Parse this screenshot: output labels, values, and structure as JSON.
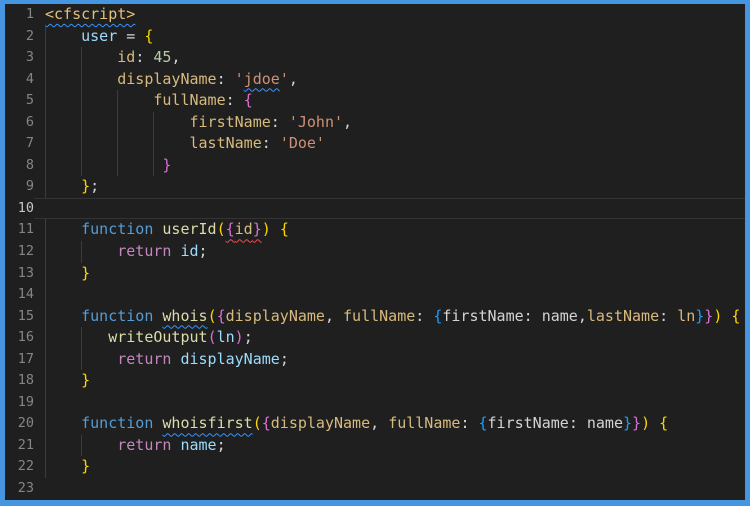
{
  "window": {
    "border_color": "#4595e0",
    "background": "#1f1f1f",
    "language": "cfml"
  },
  "editor": {
    "active_line": 10,
    "colors": {
      "keyword": "#569cd6",
      "control": "#c586c0",
      "func": "#dcdcaa",
      "var": "#9cdcfe",
      "key": "#d7ba7d",
      "str": "#ce9178",
      "num": "#b5cea8",
      "punct": "#d4d4d4",
      "plain": "#d4d4d4",
      "tag": "#e5c07b",
      "b1": "#ffd700",
      "b2": "#da70d6",
      "b3": "#179fff",
      "line_number": "#858585",
      "line_number_active": "#c6c6c6",
      "indent_guide": "#3d3d3d",
      "squiggle_info": "#3794ff",
      "squiggle_error": "#f14c4c"
    },
    "lines": [
      {
        "number": "1",
        "indent": 0,
        "guides": [],
        "tokens": [
          {
            "t": "<cfscript>",
            "c": "tag",
            "sq": "blue"
          }
        ]
      },
      {
        "number": "2",
        "indent": 4,
        "guides": [
          0
        ],
        "tokens": [
          {
            "t": "user",
            "c": "var"
          },
          {
            "t": " = ",
            "c": "punct"
          },
          {
            "t": "{",
            "c": "b1"
          }
        ]
      },
      {
        "number": "3",
        "indent": 8,
        "guides": [
          0,
          4
        ],
        "tokens": [
          {
            "t": "id",
            "c": "key"
          },
          {
            "t": ": ",
            "c": "punct"
          },
          {
            "t": "45",
            "c": "num"
          },
          {
            "t": ",",
            "c": "punct"
          }
        ]
      },
      {
        "number": "4",
        "indent": 8,
        "guides": [
          0,
          4
        ],
        "tokens": [
          {
            "t": "displayName",
            "c": "key"
          },
          {
            "t": ": ",
            "c": "punct"
          },
          {
            "t": "'",
            "c": "str"
          },
          {
            "t": "jdoe",
            "c": "str",
            "sq": "blue"
          },
          {
            "t": "'",
            "c": "str"
          },
          {
            "t": ",",
            "c": "punct"
          }
        ]
      },
      {
        "number": "5",
        "indent": 12,
        "guides": [
          0,
          4,
          8
        ],
        "tokens": [
          {
            "t": "fullName",
            "c": "key"
          },
          {
            "t": ": ",
            "c": "punct"
          },
          {
            "t": "{",
            "c": "b2"
          }
        ]
      },
      {
        "number": "6",
        "indent": 16,
        "guides": [
          0,
          4,
          8,
          12
        ],
        "tokens": [
          {
            "t": "firstName",
            "c": "key"
          },
          {
            "t": ": ",
            "c": "punct"
          },
          {
            "t": "'John'",
            "c": "str"
          },
          {
            "t": ",",
            "c": "punct"
          }
        ]
      },
      {
        "number": "7",
        "indent": 16,
        "guides": [
          0,
          4,
          8,
          12
        ],
        "tokens": [
          {
            "t": "lastName",
            "c": "key"
          },
          {
            "t": ": ",
            "c": "punct"
          },
          {
            "t": "'Doe'",
            "c": "str"
          }
        ]
      },
      {
        "number": "8",
        "indent": 13,
        "guides": [
          0,
          4,
          8,
          12
        ],
        "tokens": [
          {
            "t": "}",
            "c": "b2"
          }
        ]
      },
      {
        "number": "9",
        "indent": 4,
        "guides": [
          0
        ],
        "tokens": [
          {
            "t": "}",
            "c": "b1"
          },
          {
            "t": ";",
            "c": "punct"
          }
        ]
      },
      {
        "number": "10",
        "indent": 0,
        "guides": [],
        "tokens": []
      },
      {
        "number": "11",
        "indent": 4,
        "guides": [
          0
        ],
        "tokens": [
          {
            "t": "function ",
            "c": "keyword"
          },
          {
            "t": "userId",
            "c": "func"
          },
          {
            "t": "(",
            "c": "b1"
          },
          {
            "t": "{",
            "c": "b2",
            "sq": "red"
          },
          {
            "t": "id",
            "c": "key",
            "sq": "red"
          },
          {
            "t": "}",
            "c": "b2",
            "sq": "red"
          },
          {
            "t": ")",
            "c": "b1"
          },
          {
            "t": " ",
            "c": "punct"
          },
          {
            "t": "{",
            "c": "b1"
          }
        ]
      },
      {
        "number": "12",
        "indent": 8,
        "guides": [
          0,
          4
        ],
        "tokens": [
          {
            "t": "return ",
            "c": "control"
          },
          {
            "t": "id",
            "c": "var"
          },
          {
            "t": ";",
            "c": "punct"
          }
        ]
      },
      {
        "number": "13",
        "indent": 4,
        "guides": [
          0
        ],
        "tokens": [
          {
            "t": "}",
            "c": "b1"
          }
        ]
      },
      {
        "number": "14",
        "indent": 0,
        "guides": [
          0
        ],
        "tokens": []
      },
      {
        "number": "15",
        "indent": 4,
        "guides": [
          0
        ],
        "tokens": [
          {
            "t": "function ",
            "c": "keyword"
          },
          {
            "t": "whois",
            "c": "func",
            "sq": "blue"
          },
          {
            "t": "(",
            "c": "b1"
          },
          {
            "t": "{",
            "c": "b2"
          },
          {
            "t": "displayName",
            "c": "key"
          },
          {
            "t": ", ",
            "c": "punct"
          },
          {
            "t": "fullName",
            "c": "key"
          },
          {
            "t": ": ",
            "c": "punct"
          },
          {
            "t": "{",
            "c": "b3"
          },
          {
            "t": "firstName",
            "c": "plain"
          },
          {
            "t": ": ",
            "c": "punct"
          },
          {
            "t": "name",
            "c": "plain"
          },
          {
            "t": ",",
            "c": "punct"
          },
          {
            "t": "lastName",
            "c": "key"
          },
          {
            "t": ": ",
            "c": "punct"
          },
          {
            "t": "ln",
            "c": "key"
          },
          {
            "t": "}",
            "c": "b3"
          },
          {
            "t": "}",
            "c": "b2"
          },
          {
            "t": ")",
            "c": "b1"
          },
          {
            "t": " ",
            "c": "punct"
          },
          {
            "t": "{",
            "c": "b1"
          }
        ]
      },
      {
        "number": "16",
        "indent": 7,
        "guides": [
          0,
          4
        ],
        "tokens": [
          {
            "t": "writeOutput",
            "c": "func"
          },
          {
            "t": "(",
            "c": "b2"
          },
          {
            "t": "ln",
            "c": "var"
          },
          {
            "t": ")",
            "c": "b2"
          },
          {
            "t": ";",
            "c": "punct"
          }
        ]
      },
      {
        "number": "17",
        "indent": 8,
        "guides": [
          0,
          4
        ],
        "tokens": [
          {
            "t": "return ",
            "c": "control"
          },
          {
            "t": "displayName",
            "c": "var"
          },
          {
            "t": ";",
            "c": "punct"
          }
        ]
      },
      {
        "number": "18",
        "indent": 4,
        "guides": [
          0
        ],
        "tokens": [
          {
            "t": "}",
            "c": "b1"
          }
        ]
      },
      {
        "number": "19",
        "indent": 0,
        "guides": [
          0
        ],
        "tokens": []
      },
      {
        "number": "20",
        "indent": 4,
        "guides": [
          0
        ],
        "tokens": [
          {
            "t": "function ",
            "c": "keyword"
          },
          {
            "t": "whoisfirst",
            "c": "func",
            "sq": "blue"
          },
          {
            "t": "(",
            "c": "b1"
          },
          {
            "t": "{",
            "c": "b2"
          },
          {
            "t": "displayName",
            "c": "key"
          },
          {
            "t": ", ",
            "c": "punct"
          },
          {
            "t": "fullName",
            "c": "key"
          },
          {
            "t": ": ",
            "c": "punct"
          },
          {
            "t": "{",
            "c": "b3"
          },
          {
            "t": "firstName",
            "c": "plain"
          },
          {
            "t": ": ",
            "c": "punct"
          },
          {
            "t": "name",
            "c": "plain"
          },
          {
            "t": "}",
            "c": "b3"
          },
          {
            "t": "}",
            "c": "b2"
          },
          {
            "t": ")",
            "c": "b1"
          },
          {
            "t": " ",
            "c": "punct"
          },
          {
            "t": "{",
            "c": "b1"
          }
        ]
      },
      {
        "number": "21",
        "indent": 8,
        "guides": [
          0,
          4
        ],
        "tokens": [
          {
            "t": "return ",
            "c": "control"
          },
          {
            "t": "name",
            "c": "var"
          },
          {
            "t": ";",
            "c": "punct"
          }
        ]
      },
      {
        "number": "22",
        "indent": 4,
        "guides": [
          0
        ],
        "tokens": [
          {
            "t": "}",
            "c": "b1"
          }
        ]
      },
      {
        "number": "23",
        "indent": 0,
        "guides": [],
        "tokens": []
      }
    ]
  }
}
